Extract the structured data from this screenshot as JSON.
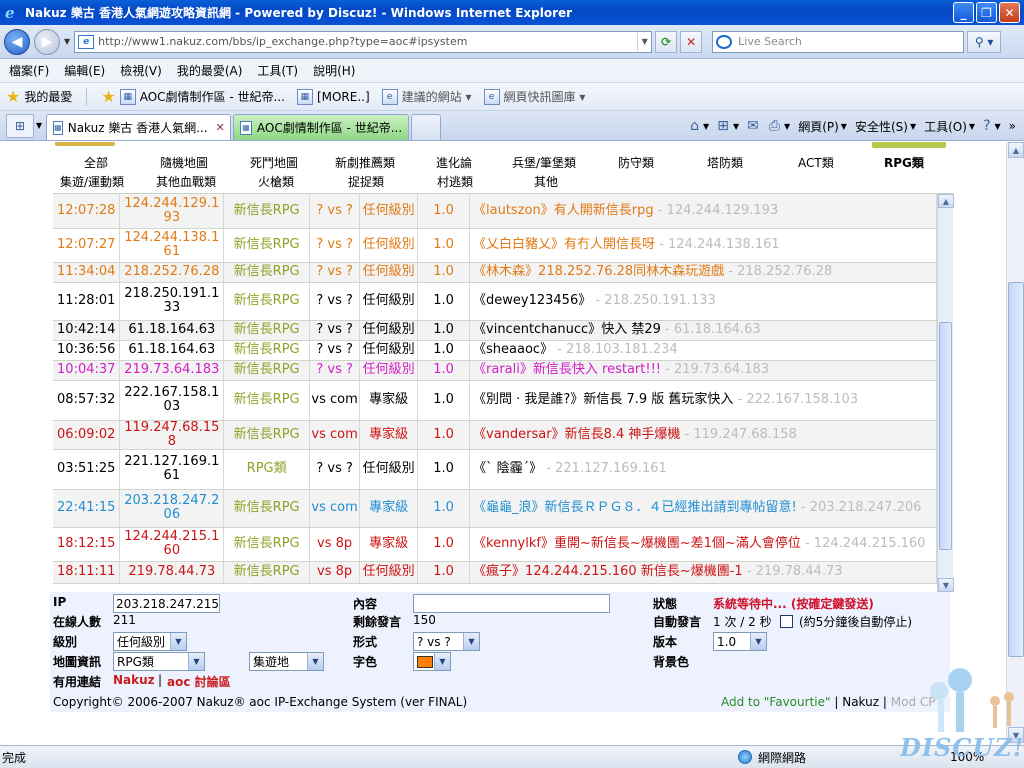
{
  "window": {
    "title": "Nakuz 樂古 香港人氣網遊攻略資訊網 - Powered by Discuz! - Windows Internet Explorer",
    "colors": {
      "titlebar": "#0a52d6",
      "tab_inactive": "#8fd784"
    }
  },
  "address": {
    "url": "http://www1.nakuz.com/bbs/ip_exchange.php?type=aoc#ipsystem",
    "search_placeholder": "Live Search"
  },
  "menu": [
    "檔案(F)",
    "編輯(E)",
    "檢視(V)",
    "我的最愛(A)",
    "工具(T)",
    "說明(H)"
  ],
  "favorites": {
    "my_fav": "我的最愛",
    "items": [
      "AOC劇情制作區 - 世紀帝...",
      "[MORE..]",
      "建議的網站 ▾",
      "網頁快訊圖庫 ▾"
    ]
  },
  "tabs": {
    "active": "Nakuz 樂古 香港人氣網...",
    "inactive": "AOC劇情制作區 - 世紀帝..."
  },
  "commands": {
    "page": "網頁(P)",
    "safety": "安全性(S)",
    "tools": "工具(O)"
  },
  "categories": {
    "row1": [
      "全部",
      "隨機地圖",
      "死鬥地圖",
      "新劇推薦類",
      "進化論",
      "兵堡/筆堡類",
      "防守類",
      "塔防類",
      "ACT類",
      "RPG類"
    ],
    "row2": [
      "集遊/運動類",
      "其他血戰類",
      "火槍類",
      "捉捉類",
      "村逃類",
      "其他"
    ]
  },
  "log": [
    {
      "time": "12:07:28",
      "ip": "124.244.129.193",
      "type": "新信長RPG",
      "vs": "? vs ?",
      "level": "任何級別",
      "ver": "1.0",
      "user": "lautszon",
      "msg": "有人開新信長rpg",
      "ip2": "124.244.129.193",
      "color": "#e07a14"
    },
    {
      "time": "12:07:27",
      "ip": "124.244.138.161",
      "type": "新信長RPG",
      "vs": "? vs ?",
      "level": "任何級別",
      "ver": "1.0",
      "user": "乂白白豬乂",
      "msg": "有冇人開信長呀",
      "ip2": "124.244.138.161",
      "color": "#e07a14"
    },
    {
      "time": "11:34:04",
      "ip": "218.252.76.28",
      "type": "新信長RPG",
      "vs": "? vs ?",
      "level": "任何級別",
      "ver": "1.0",
      "user": "林木森",
      "msg": "218.252.76.28同林木森玩遊戲",
      "ip2": "218.252.76.28",
      "color": "#e07a14"
    },
    {
      "time": "11:28:01",
      "ip": "218.250.191.133",
      "type": "新信長RPG",
      "vs": "? vs ?",
      "level": "任何級別",
      "ver": "1.0",
      "user": "dewey123456",
      "msg": "",
      "ip2": "218.250.191.133",
      "color": "#000000"
    },
    {
      "time": "10:42:14",
      "ip": "61.18.164.63",
      "type": "新信長RPG",
      "vs": "? vs ?",
      "level": "任何級別",
      "ver": "1.0",
      "user": "vincentchanucc",
      "msg": "快入 禁29",
      "ip2": "61.18.164.63",
      "color": "#000000"
    },
    {
      "time": "10:36:56",
      "ip": "61.18.164.63",
      "type": "新信長RPG",
      "vs": "? vs ?",
      "level": "任何級別",
      "ver": "1.0",
      "user": "sheaaoc",
      "msg": "",
      "ip2": "218.103.181.234",
      "color": "#000000"
    },
    {
      "time": "10:04:37",
      "ip": "219.73.64.183",
      "type": "新信長RPG",
      "vs": "? vs ?",
      "level": "任何級別",
      "ver": "1.0",
      "user": "rarali",
      "msg": "新信長快入 restart!!!",
      "ip2": "219.73.64.183",
      "color": "#d020c8"
    },
    {
      "time": "08:57:32",
      "ip": "222.167.158.103",
      "type": "新信長RPG",
      "vs": "vs com",
      "level": "專家級",
      "ver": "1.0",
      "user": "別問 · 我是誰?",
      "msg": "新信長 7.9 版 舊玩家快入",
      "ip2": "222.167.158.103",
      "color": "#000000"
    },
    {
      "time": "06:09:02",
      "ip": "119.247.68.158",
      "type": "新信長RPG",
      "vs": "vs com",
      "level": "專家級",
      "ver": "1.0",
      "user": "vandersar",
      "msg": "新信長8.4 神手爆機",
      "ip2": "119.247.68.158",
      "color": "#cc1414"
    },
    {
      "time": "03:51:25",
      "ip": "221.127.169.161",
      "type": "RPG類",
      "vs": "? vs ?",
      "level": "任何級別",
      "ver": "1.0",
      "user": "ˋ 陰霾ˊ",
      "msg": "",
      "ip2": "221.127.169.161",
      "color": "#000000"
    },
    {
      "time": "22:41:15",
      "ip": "203.218.247.206",
      "type": "新信長RPG",
      "vs": "vs com",
      "level": "專家級",
      "ver": "1.0",
      "user": "龜龜_浪",
      "msg": "新信長ＲＰＧ８．４已經推出請到專帖留意!",
      "ip2": "203.218.247.206",
      "color": "#1f8fd0"
    },
    {
      "time": "18:12:15",
      "ip": "124.244.215.160",
      "type": "新信長RPG",
      "vs": "vs 8p",
      "level": "專家級",
      "ver": "1.0",
      "user": "kennylkf",
      "msg": "重開~新信長~爆機團~差1個~滿人會停位",
      "ip2": "124.244.215.160",
      "color": "#cc1414"
    },
    {
      "time": "18:11:11",
      "ip": "219.78.44.73",
      "type": "新信長RPG",
      "vs": "vs 8p",
      "level": "任何級別",
      "ver": "1.0",
      "user": "瘋子",
      "msg": "124.244.215.160 新信長~爆機團-1",
      "ip2": "219.78.44.73",
      "color": "#cc1414"
    }
  ],
  "form": {
    "ip_label": "IP",
    "ip_value": "203.218.247.215",
    "online_label": "在線人數",
    "online_value": "211",
    "level_label": "級別",
    "level_value": "任何級別",
    "map_label": "地圖資訊",
    "map_value1": "RPG類",
    "map_value2": "集遊地",
    "links_label": "有用連結",
    "link1": "Nakuz",
    "link_sep": "|",
    "link2": "aoc 討論區",
    "content_label": "內容",
    "content_value": "",
    "remain_label": "剩餘發言",
    "remain_value": "150",
    "mode_label": "形式",
    "mode_value": "? vs ?",
    "color_label": "字色",
    "status_label": "狀態",
    "status_value": "系統等待中... (按確定鍵發送)",
    "auto_label": "自動發言",
    "auto_value": "1 次 / 2 秒",
    "auto_note": "(約5分鐘後自動停止)",
    "ver_label": "版本",
    "ver_value": "1.0",
    "bg_label": "背景色"
  },
  "footer": {
    "copyright": "Copyright© 2006-2007  Nakuz® aoc IP-Exchange System (ver FINAL)",
    "fav": "Add to \"Favourtie\"",
    "sep1": "|",
    "nakuz": "Nakuz",
    "sep2": "|",
    "mod": "Mod CP"
  },
  "statusbar": {
    "done": "完成",
    "zone": "網際網路",
    "zoom": "100%"
  },
  "branding": {
    "discuz": "DISCUZ!"
  }
}
